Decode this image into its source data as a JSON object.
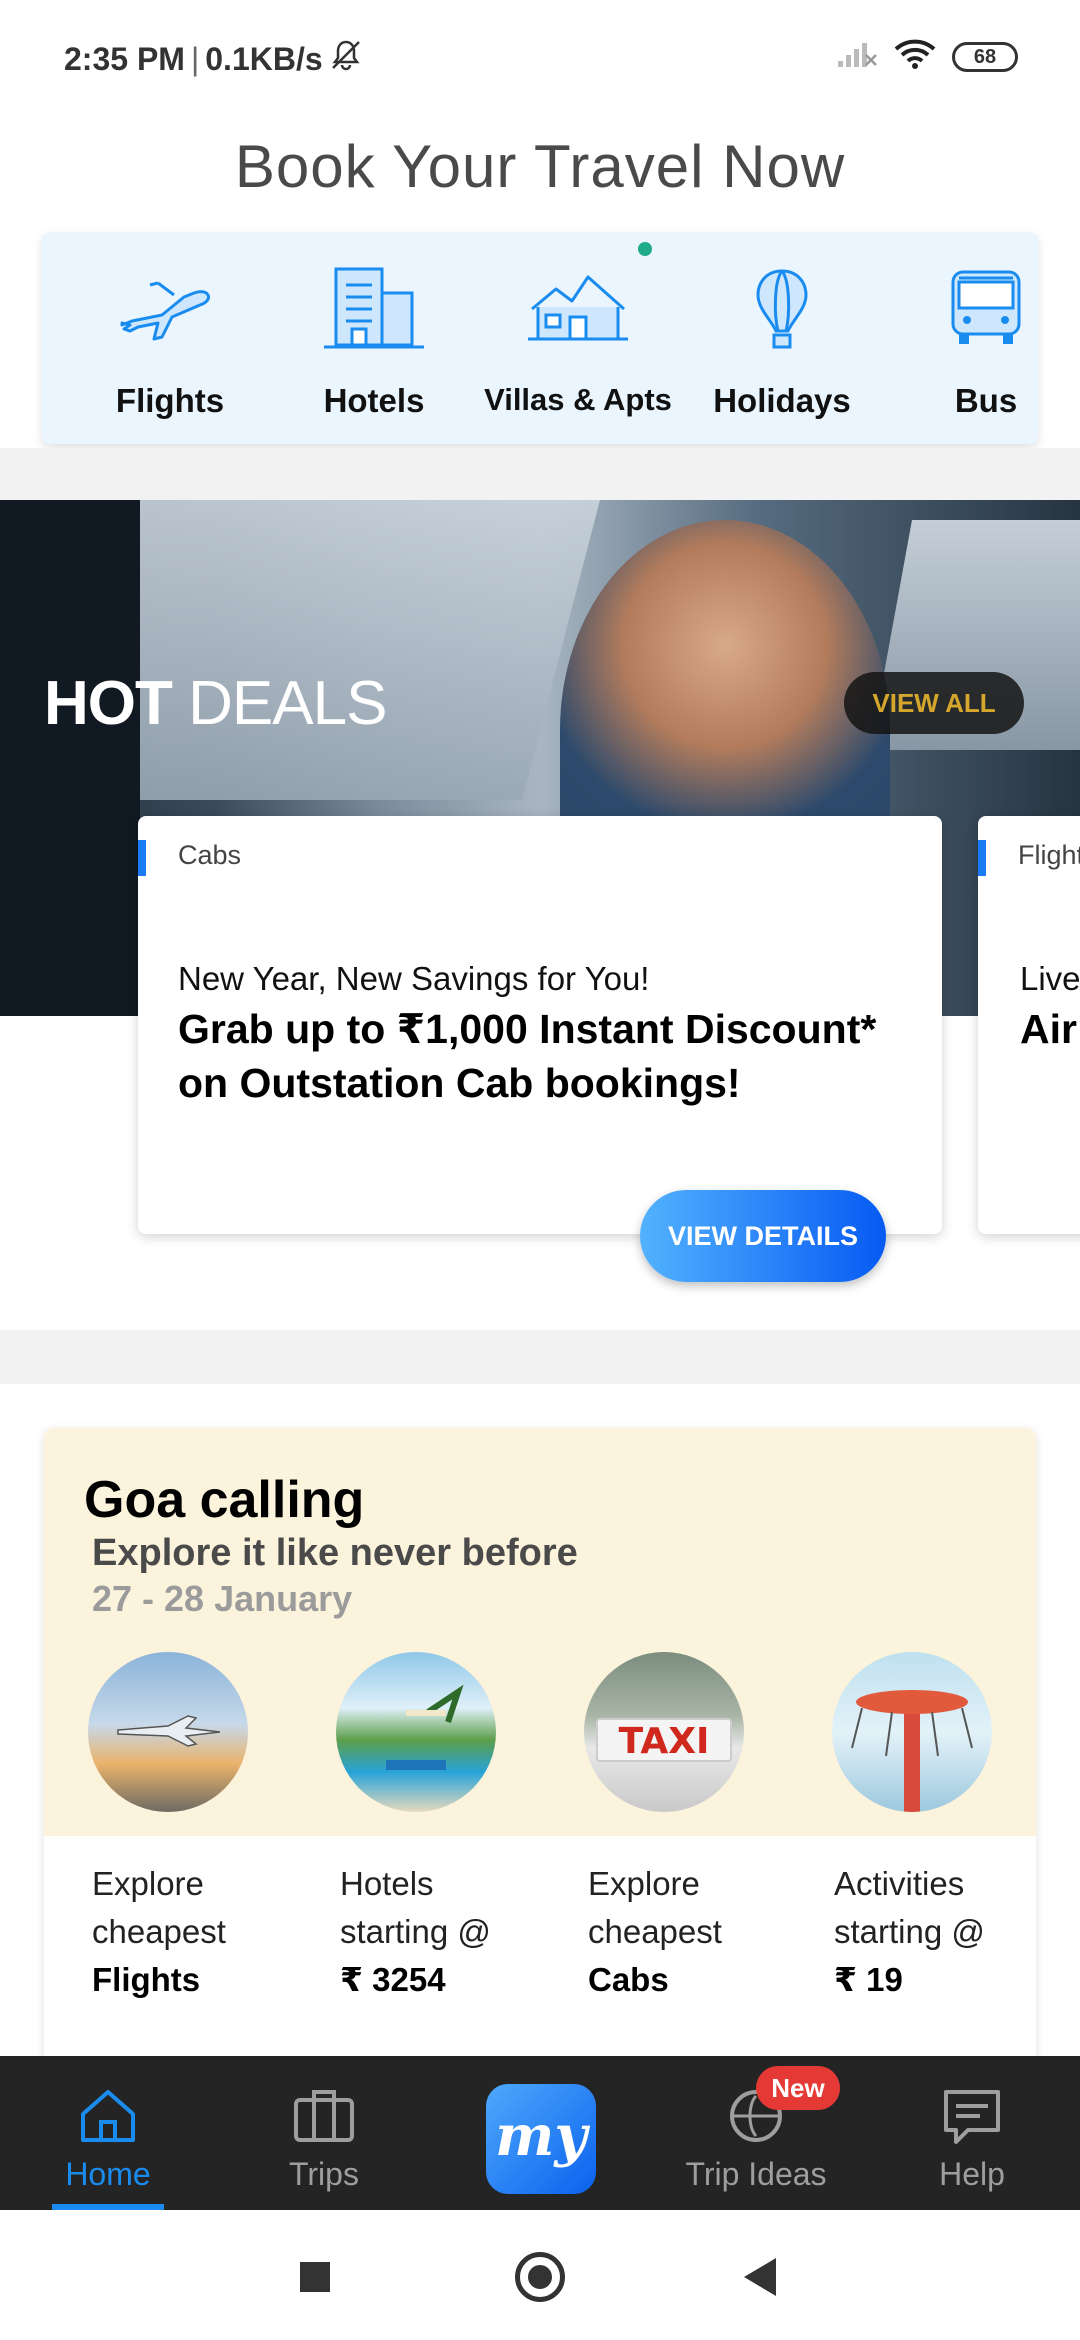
{
  "status_bar": {
    "time": "2:35 PM",
    "separator": "|",
    "speed": "0.1KB/s",
    "battery": "68"
  },
  "header": {
    "title": "Book Your Travel Now"
  },
  "categories": [
    {
      "label": "Flights",
      "icon": "airplane-icon"
    },
    {
      "label": "Hotels",
      "icon": "hotel-building-icon"
    },
    {
      "label": "Villas & Apts",
      "icon": "villa-house-icon"
    },
    {
      "label": "Holidays",
      "icon": "hot-air-balloon-icon"
    },
    {
      "label": "Bus",
      "icon": "bus-icon"
    }
  ],
  "hot_deals": {
    "title_bold": "HOT",
    "title_light": " DEALS",
    "view_all": "VIEW ALL",
    "cards": [
      {
        "tag": "Cabs",
        "subtitle": "New Year, New Savings for You!",
        "headline": "Grab up to ₹1,000 Instant Discount* on Outstation Cab bookings!",
        "cta": "VIEW DETAILS"
      },
      {
        "tag": "Flight",
        "subtitle": "Live",
        "headline": "Air"
      }
    ]
  },
  "goa": {
    "title": "Goa calling",
    "subtitle": "Explore it like never before",
    "dates": "27 - 28 January",
    "items": [
      {
        "line1": "Explore",
        "line2": "cheapest",
        "line3": "Flights"
      },
      {
        "line1": "Hotels",
        "line2": "starting @",
        "line3": "₹ 3254"
      },
      {
        "line1": "Explore",
        "line2": "cheapest",
        "line3": "Cabs"
      },
      {
        "line1": "Activities",
        "line2": "starting @",
        "line3": "₹ 19"
      }
    ],
    "taxi_sign": "TAXI"
  },
  "bottom_nav": {
    "items": [
      {
        "label": "Home",
        "icon": "home-icon",
        "active": true
      },
      {
        "label": "Trips",
        "icon": "suitcase-icon"
      },
      {
        "label": "my",
        "icon": "my-logo"
      },
      {
        "label": "Trip Ideas",
        "icon": "compass-icon",
        "badge": "New"
      },
      {
        "label": "Help",
        "icon": "chat-help-icon"
      }
    ]
  },
  "colors": {
    "accent_blue": "#1a8cf0",
    "category_bg": "#eaf5fe",
    "goa_bg": "#fcf3dc",
    "view_all_text": "#d4a72c",
    "badge_red": "#e53935"
  }
}
